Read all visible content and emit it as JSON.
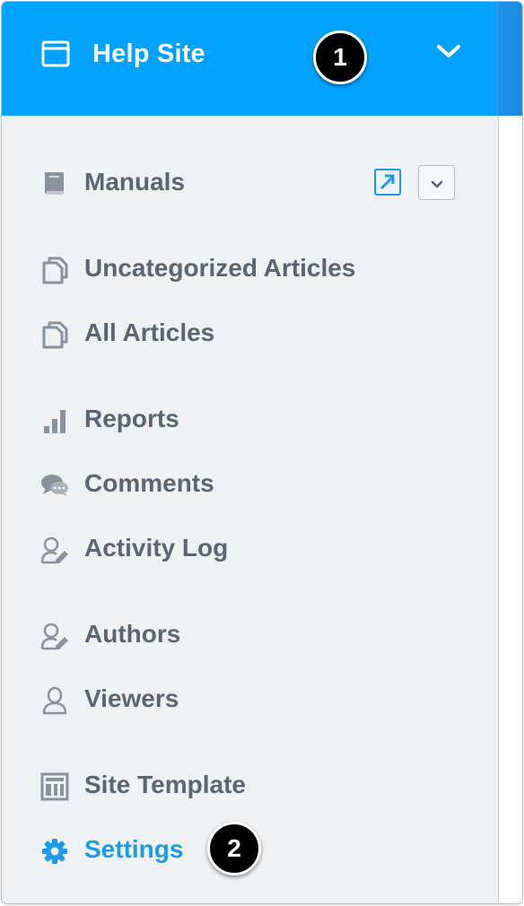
{
  "header": {
    "site_title": "Help Site",
    "site_icon": "browser-window-icon",
    "chevron_icon": "chevron-down-icon",
    "background_color": "#00a2ff"
  },
  "badges": {
    "first": "1",
    "second": "2"
  },
  "manuals_actions": {
    "external_icon": "external-link-icon",
    "dropdown_icon": "chevron-down-icon"
  },
  "nav": {
    "manuals": {
      "label": "Manuals",
      "icon": "book-icon"
    },
    "uncategorized": {
      "label": "Uncategorized Articles",
      "icon": "copy-documents-icon"
    },
    "all_articles": {
      "label": "All Articles",
      "icon": "copy-documents-icon"
    },
    "reports": {
      "label": "Reports",
      "icon": "bar-chart-icon"
    },
    "comments": {
      "label": "Comments",
      "icon": "speech-bubbles-icon"
    },
    "activity_log": {
      "label": "Activity Log",
      "icon": "user-edit-icon"
    },
    "authors": {
      "label": "Authors",
      "icon": "user-edit-icon"
    },
    "viewers": {
      "label": "Viewers",
      "icon": "user-icon"
    },
    "site_template": {
      "label": "Site Template",
      "icon": "template-icon"
    },
    "settings": {
      "label": "Settings",
      "icon": "gear-icon",
      "active": true
    }
  },
  "colors": {
    "accent": "#00a2ff",
    "active_text": "#1a9ce8",
    "label_text": "#5b6573",
    "sidebar_bg": "#eff1f3"
  }
}
